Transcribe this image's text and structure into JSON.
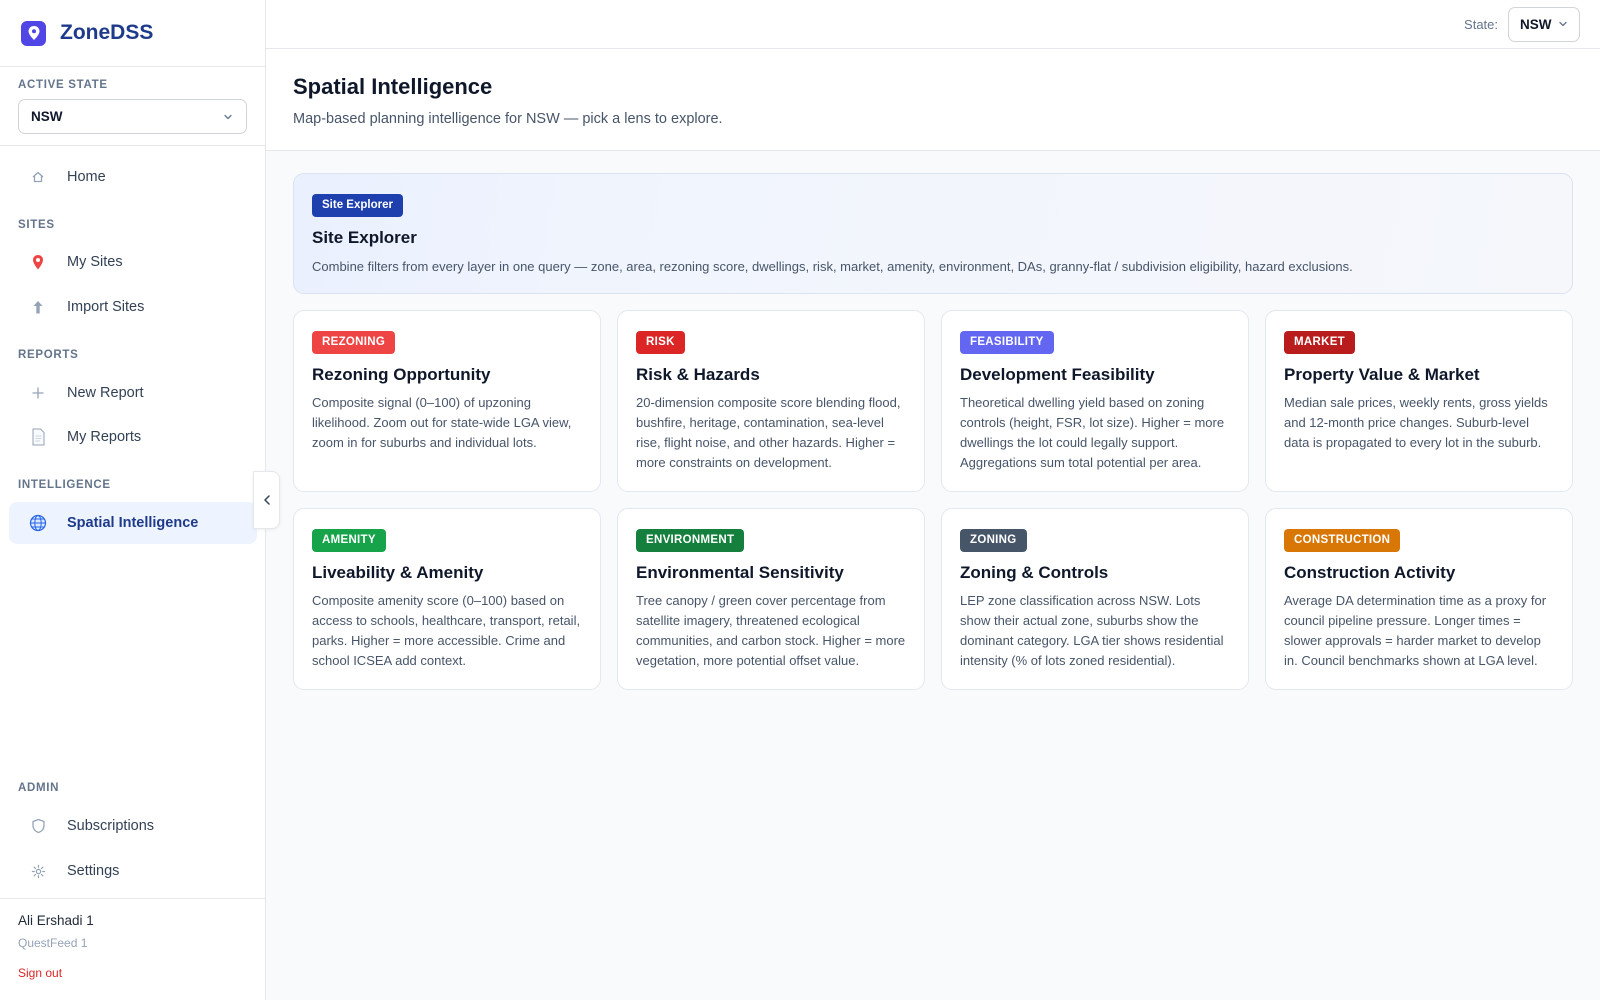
{
  "app": {
    "name": "ZoneDSS"
  },
  "sidebar": {
    "active_state_label": "ACTIVE STATE",
    "active_state_value": "NSW",
    "sections": {
      "sites": "SITES",
      "reports": "REPORTS",
      "intelligence": "INTELLIGENCE",
      "admin": "ADMIN"
    },
    "items": {
      "home": "Home",
      "my_sites": "My Sites",
      "import_sites": "Import Sites",
      "new_report": "New Report",
      "my_reports": "My Reports",
      "spatial_intelligence": "Spatial Intelligence",
      "subscriptions": "Subscriptions",
      "settings": "Settings"
    },
    "user": {
      "name": "Ali Ershadi 1",
      "org": "QuestFeed 1",
      "sign_out": "Sign out"
    }
  },
  "topbar": {
    "state_label": "State:",
    "state_value": "NSW"
  },
  "page": {
    "title": "Spatial Intelligence",
    "subtitle": "Map-based planning intelligence for NSW — pick a lens to explore."
  },
  "hero": {
    "badge": "Site Explorer",
    "title": "Site Explorer",
    "description": "Combine filters from every layer in one query — zone, area, rezoning score, dwellings, risk, market, amenity, environment, DAs, granny-flat / subdivision eligibility, hazard exclusions."
  },
  "cards": [
    {
      "badge": "REZONING",
      "badge_color": "#ef4444",
      "title": "Rezoning Opportunity",
      "description": "Composite signal (0–100) of upzoning likelihood. Zoom out for state-wide LGA view, zoom in for suburbs and individual lots."
    },
    {
      "badge": "RISK",
      "badge_color": "#dc2626",
      "title": "Risk & Hazards",
      "description": "20-dimension composite score blending flood, bushfire, heritage, contamination, sea-level rise, flight noise, and other hazards. Higher = more constraints on development."
    },
    {
      "badge": "FEASIBILITY",
      "badge_color": "#6366f1",
      "title": "Development Feasibility",
      "description": "Theoretical dwelling yield based on zoning controls (height, FSR, lot size). Higher = more dwellings the lot could legally support. Aggregations sum total potential per area."
    },
    {
      "badge": "MARKET",
      "badge_color": "#b91c1c",
      "title": "Property Value & Market",
      "description": "Median sale prices, weekly rents, gross yields and 12-month price changes. Suburb-level data is propagated to every lot in the suburb."
    },
    {
      "badge": "AMENITY",
      "badge_color": "#16a34a",
      "title": "Liveability & Amenity",
      "description": "Composite amenity score (0–100) based on access to schools, healthcare, transport, retail, parks. Higher = more accessible. Crime and school ICSEA add context."
    },
    {
      "badge": "ENVIRONMENT",
      "badge_color": "#15803d",
      "title": "Environmental Sensitivity",
      "description": "Tree canopy / green cover percentage from satellite imagery, threatened ecological communities, and carbon stock. Higher = more vegetation, more potential offset value."
    },
    {
      "badge": "ZONING",
      "badge_color": "#475569",
      "title": "Zoning & Controls",
      "description": "LEP zone classification across NSW. Lots show their actual zone, suburbs show the dominant category. LGA tier shows residential intensity (% of lots zoned residential)."
    },
    {
      "badge": "CONSTRUCTION",
      "badge_color": "#d97706",
      "title": "Construction Activity",
      "description": "Average DA determination time as a proxy for council pipeline pressure. Longer times = slower approvals = harder market to develop in. Council benchmarks shown at LGA level."
    }
  ]
}
